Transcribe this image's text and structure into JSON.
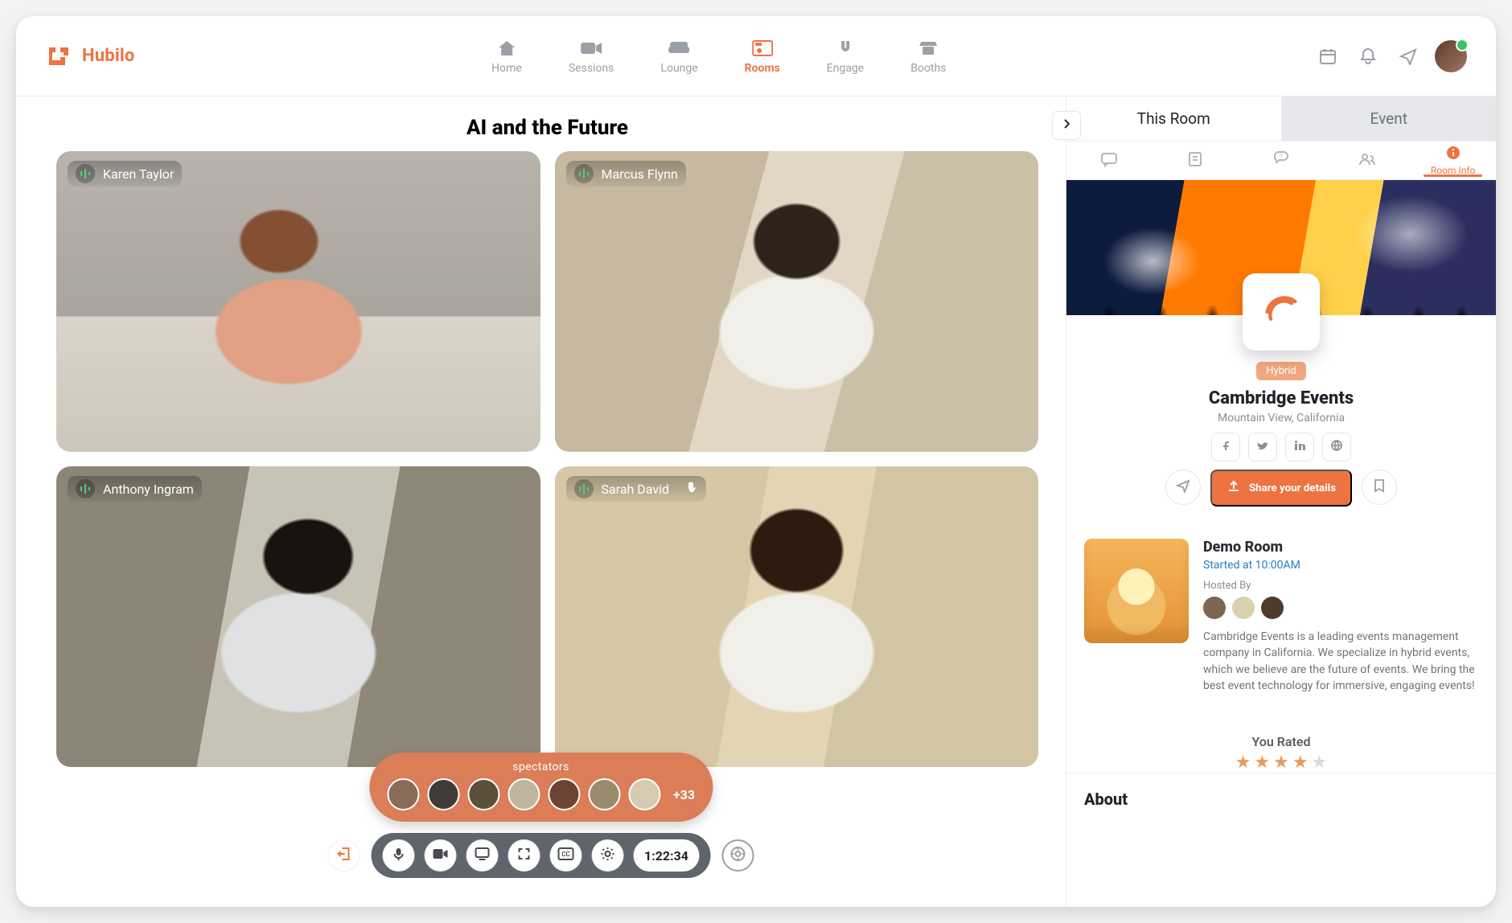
{
  "brand": {
    "name": "Hubilo"
  },
  "nav": {
    "items": [
      {
        "label": "Home",
        "icon": "home-icon"
      },
      {
        "label": "Sessions",
        "icon": "camera-icon"
      },
      {
        "label": "Lounge",
        "icon": "sofa-icon"
      },
      {
        "label": "Rooms",
        "icon": "room-icon",
        "active": true
      },
      {
        "label": "Engage",
        "icon": "magnet-icon"
      },
      {
        "label": "Booths",
        "icon": "booth-icon"
      }
    ]
  },
  "top_actions": {
    "agenda": "agenda-icon",
    "bell": "bell-icon",
    "send": "send-icon",
    "avatar": "avatar"
  },
  "meeting": {
    "title": "AI and the Future",
    "participants": [
      {
        "name": "Karen Taylor",
        "hand_raised": false
      },
      {
        "name": "Marcus Flynn",
        "hand_raised": false
      },
      {
        "name": "Anthony Ingram",
        "hand_raised": false
      },
      {
        "name": "Sarah David",
        "hand_raised": true
      }
    ],
    "spectators": {
      "label": "spectators",
      "overflow": "+33",
      "avatars": 7
    },
    "controls": {
      "timer": "1:22:34",
      "items": [
        "leave",
        "mic",
        "camera",
        "present",
        "expand",
        "cc",
        "settings"
      ]
    }
  },
  "side": {
    "tabs": {
      "primary": [
        "This Room",
        "Event"
      ],
      "active_index": 0
    },
    "subtabs": [
      "chat-icon",
      "notes-icon",
      "qa-icon",
      "people-icon",
      "info-icon"
    ],
    "subtab_active_index": 4,
    "subtab_active_label": "Room Info",
    "org": {
      "badge": "Hybrid",
      "name": "Cambridge Events",
      "location": "Mountain View, California",
      "socials": [
        "facebook",
        "twitter",
        "linkedin",
        "website"
      ],
      "cta": "Share your details"
    },
    "room": {
      "title": "Demo Room",
      "time": "Started at 10:00AM",
      "hosted_by": "Hosted By",
      "description": "Cambridge Events is a leading events management company in California. We specialize in hybrid events, which we believe are the future of events. We bring the best event technology for immersive, engaging events!",
      "rated_label": "You Rated",
      "stars": 4
    },
    "about": "About"
  }
}
